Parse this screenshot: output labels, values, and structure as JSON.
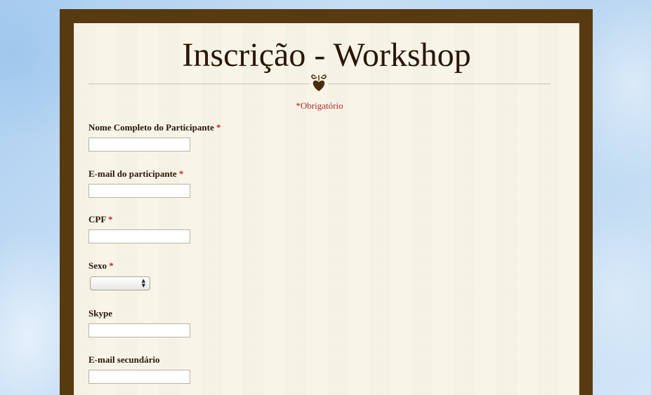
{
  "form": {
    "title": "Inscrição - Workshop",
    "required_note": "*Obrigatório",
    "ornament_icon": "heart-flourish-icon",
    "required_marker": "*",
    "fields": [
      {
        "label": "Nome Completo do Participante",
        "required": true,
        "type": "text",
        "value": ""
      },
      {
        "label": "E-mail do participante",
        "required": true,
        "type": "text",
        "value": ""
      },
      {
        "label": "CPF",
        "required": true,
        "type": "text",
        "value": ""
      },
      {
        "label": "Sexo",
        "required": true,
        "type": "select",
        "value": ""
      },
      {
        "label": "Skype",
        "required": false,
        "type": "text",
        "value": ""
      },
      {
        "label": "E-mail secundário",
        "required": false,
        "type": "text",
        "value": ""
      }
    ]
  },
  "colors": {
    "frame": "#573a0f",
    "paper": "#f8f5e8",
    "required": "#c0272d",
    "text": "#2a1606",
    "background": "#b7d5f1"
  }
}
